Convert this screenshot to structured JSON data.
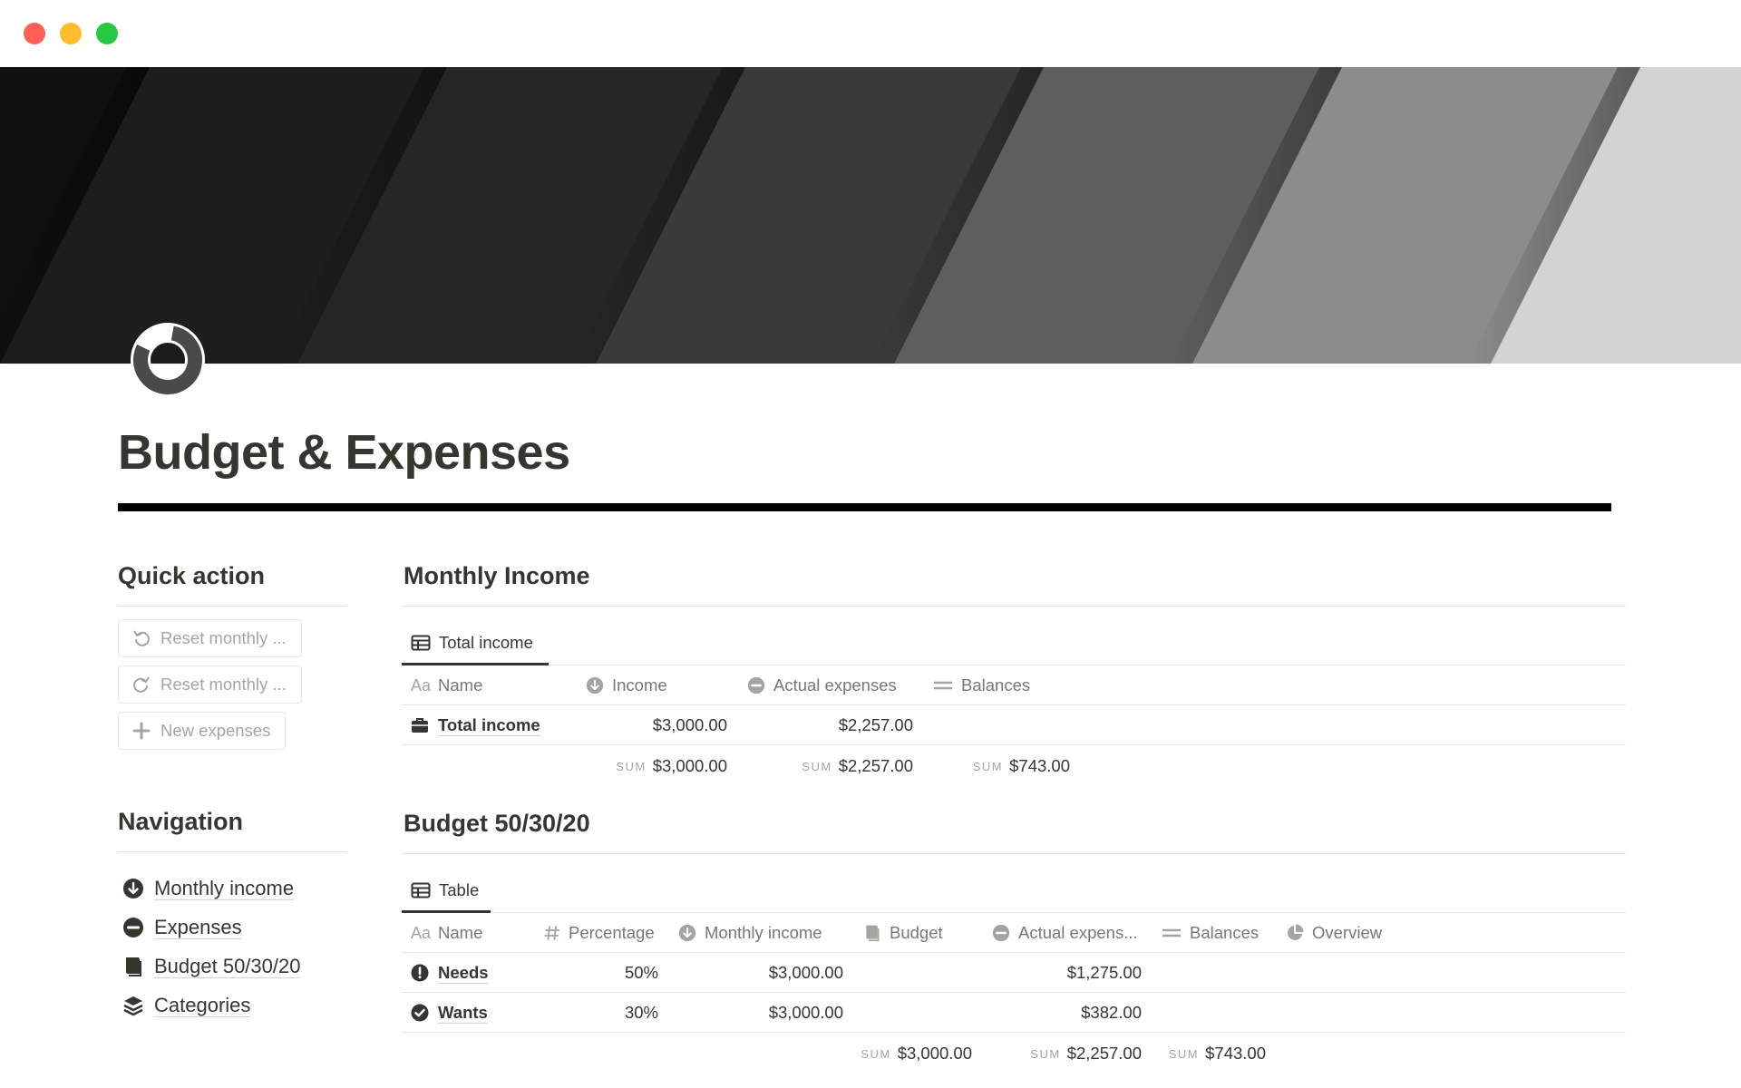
{
  "window": {
    "controls": [
      "close",
      "minimize",
      "zoom"
    ]
  },
  "cover": {
    "style": "diagonal grayscale stripes",
    "colors": [
      "#0f0f0f",
      "#1d1d1d",
      "#262626",
      "#3a3a3a",
      "#5e5e5e",
      "#8c8c8c",
      "#d3d3d3"
    ]
  },
  "page": {
    "icon": "donut-chart-icon",
    "title": "Budget & Expenses"
  },
  "quick_action": {
    "heading": "Quick action",
    "buttons": [
      {
        "label": "Reset monthly ...",
        "icon": "undo-arrow-icon"
      },
      {
        "label": "Reset monthly ...",
        "icon": "redo-arrow-icon"
      },
      {
        "label": "New expenses",
        "icon": "plus-icon"
      }
    ]
  },
  "navigation": {
    "heading": "Navigation",
    "items": [
      {
        "label": "Monthly income",
        "icon": "arrow-down-circle-icon"
      },
      {
        "label": "Expenses",
        "icon": "minus-circle-icon"
      },
      {
        "label": "Budget 50/30/20",
        "icon": "book-icon"
      },
      {
        "label": "Categories",
        "icon": "layers-icon"
      }
    ]
  },
  "monthly_income": {
    "title": "Monthly Income",
    "tab": "Total income",
    "columns": [
      {
        "label": "Name",
        "icon": "aa-text-icon"
      },
      {
        "label": "Income",
        "icon": "arrow-down-circle-icon"
      },
      {
        "label": "Actual expenses",
        "icon": "minus-circle-icon"
      },
      {
        "label": "Balances",
        "icon": "equals-icon"
      }
    ],
    "rows": [
      {
        "name": "Total income",
        "icon": "briefcase-icon",
        "income": "$3,000.00",
        "actual_expenses": "$2,257.00",
        "balances": ""
      }
    ],
    "sums": {
      "label": "SUM",
      "income": "$3,000.00",
      "actual_expenses": "$2,257.00",
      "balances": "$743.00"
    }
  },
  "budget": {
    "title": "Budget 50/30/20",
    "tab": "Table",
    "columns": [
      {
        "label": "Name",
        "icon": "aa-text-icon"
      },
      {
        "label": "Percentage",
        "icon": "hash-icon"
      },
      {
        "label": "Monthly income",
        "icon": "arrow-down-circle-icon"
      },
      {
        "label": "Budget",
        "icon": "book-icon"
      },
      {
        "label": "Actual expens...",
        "icon": "minus-circle-icon"
      },
      {
        "label": "Balances",
        "icon": "equals-icon"
      },
      {
        "label": "Overview",
        "icon": "pie-chart-icon"
      }
    ],
    "rows": [
      {
        "name": "Needs",
        "icon": "exclamation-circle-icon",
        "percentage": "50%",
        "monthly_income": "$3,000.00",
        "budget": "",
        "actual_expenses": "$1,275.00",
        "balances": "",
        "overview": ""
      },
      {
        "name": "Wants",
        "icon": "check-circle-icon",
        "percentage": "30%",
        "monthly_income": "$3,000.00",
        "budget": "",
        "actual_expenses": "$382.00",
        "balances": "",
        "overview": ""
      }
    ],
    "sums": {
      "label": "SUM",
      "budget": "$3,000.00",
      "actual_expenses": "$2,257.00",
      "balances": "$743.00"
    }
  }
}
